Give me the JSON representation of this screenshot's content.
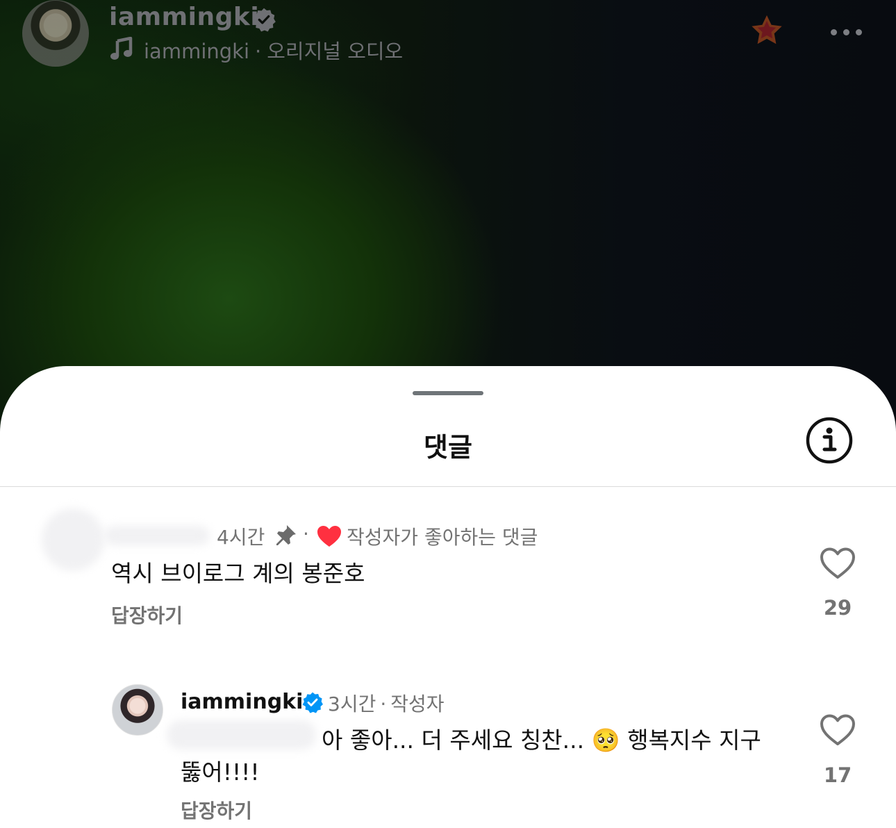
{
  "header": {
    "username": "iammingki",
    "audio_owner": "iammingki",
    "separator": "·",
    "audio_label": "오리지널 오디오",
    "icons": [
      "verified-badge-icon",
      "music-note-icon",
      "star-icon",
      "more-icon"
    ]
  },
  "sheet": {
    "title": "댓글",
    "info_icon": "info-icon"
  },
  "comments": [
    {
      "time": "4시간",
      "separator": "·",
      "creator_liked_label": "작성자가 좋아하는 댓글",
      "text": "역시 브이로그 계의 봉준호",
      "reply_label": "답장하기",
      "like_count": "29"
    },
    {
      "username": "iammingki",
      "time": "3시간",
      "separator": "·",
      "author_label": "작성자",
      "text_line1": "아 좋아... 더 주세요 칭찬... 🥺 행복지수 지구",
      "text_line2": "뚫어!!!!",
      "reply_label": "답장하기",
      "like_count": "17"
    }
  ],
  "colors": {
    "accent_red": "#ff3040",
    "verified_blue": "#0095f6",
    "muted_text": "#737373"
  }
}
